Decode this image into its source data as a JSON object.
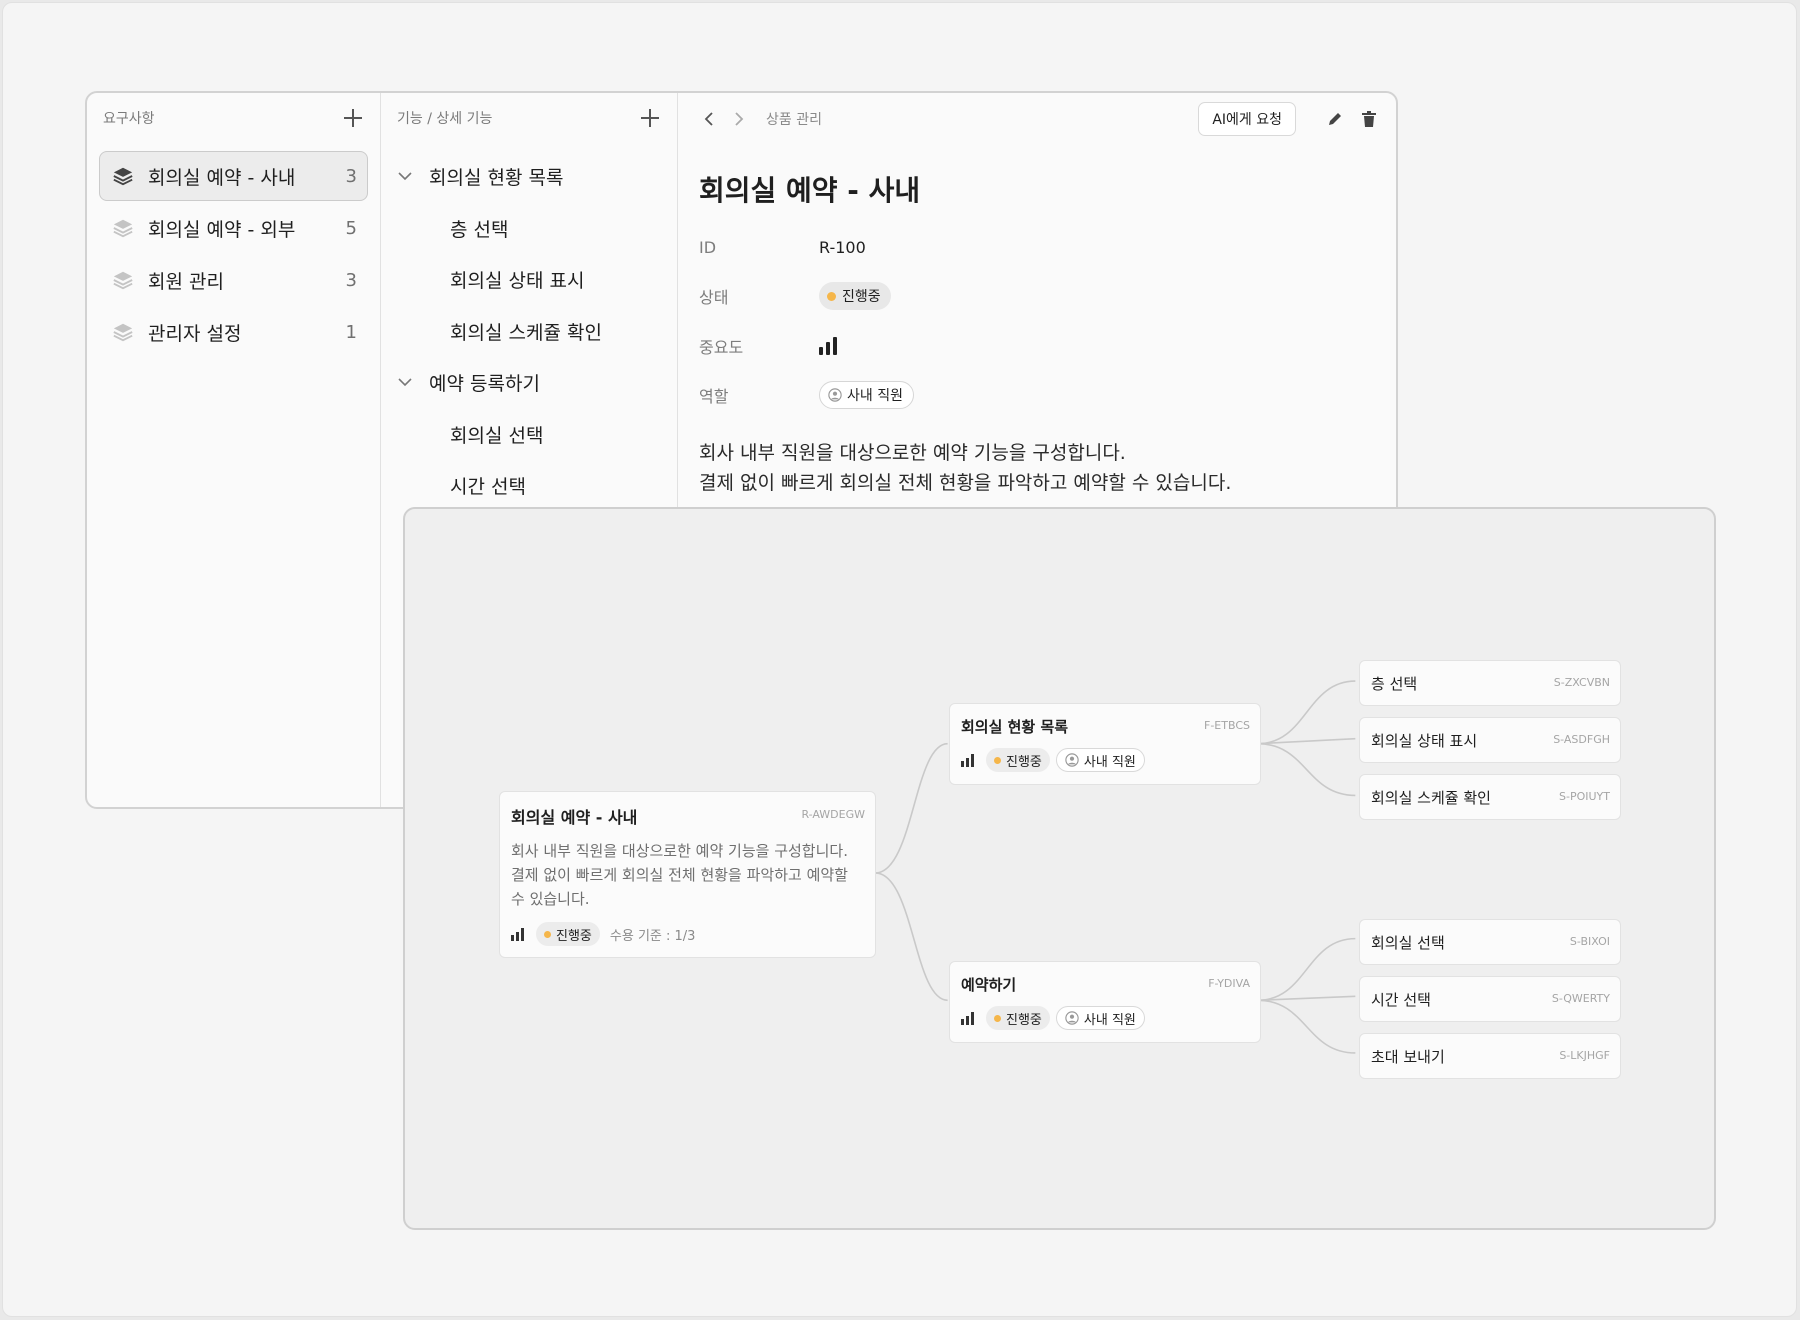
{
  "requirements_panel": {
    "header": "요구사항",
    "items": [
      {
        "label": "회의실 예약 - 사내",
        "count": "3"
      },
      {
        "label": "회의실 예약 - 외부",
        "count": "5"
      },
      {
        "label": "회원 관리",
        "count": "3"
      },
      {
        "label": "관리자 설정",
        "count": "1"
      }
    ]
  },
  "features_panel": {
    "header": "기능 / 상세 기능",
    "groups": [
      {
        "label": "회의실 현황 목록",
        "children": [
          "층 선택",
          "회의실 상태 표시",
          "회의실 스케쥴 확인"
        ]
      },
      {
        "label": "예약 등록하기",
        "children": [
          "회의실 선택",
          "시간 선택"
        ]
      }
    ]
  },
  "detail": {
    "breadcrumb": "상품 관리",
    "ai_button": "AI에게 요청",
    "title": "회의실 예약 - 사내",
    "fields": {
      "id_label": "ID",
      "id_value": "R-100",
      "status_label": "상태",
      "status_value": "진행중",
      "priority_label": "중요도",
      "role_label": "역할",
      "role_value": "사내 직원"
    },
    "description_line1": "회사 내부 직원을 대상으로한 예약 기능을 구성합니다.",
    "description_line2": "결제 없이 빠르게 회의실 전체 현황을 파악하고 예약할 수 있습니다."
  },
  "diagram": {
    "root": {
      "title": "회의실 예약 - 사내",
      "code": "R-AWDEGW",
      "description": "회사 내부 직원을 대상으로한 예약 기능을 구성합니다. 결제 없이 빠르게 회의실 전체 현황을 파악하고 예약할 수 있습니다.",
      "status": "진행중",
      "acceptance": "수용 기준 : 1/3"
    },
    "features": [
      {
        "title": "회의실 현황 목록",
        "code": "F-ETBCS",
        "status": "진행중",
        "role": "사내 직원"
      },
      {
        "title": "예약하기",
        "code": "F-YDIVA",
        "status": "진행중",
        "role": "사내 직원"
      }
    ],
    "subfeatures": [
      {
        "title": "층 선택",
        "code": "S-ZXCVBN"
      },
      {
        "title": "회의실 상태 표시",
        "code": "S-ASDFGH"
      },
      {
        "title": "회의실 스케쥴 확인",
        "code": "S-POIUYT"
      },
      {
        "title": "회의실 선택",
        "code": "S-BIXOI"
      },
      {
        "title": "시간 선택",
        "code": "S-QWERTY"
      },
      {
        "title": "초대 보내기",
        "code": "S-LKJHGF"
      }
    ]
  },
  "colors": {
    "status_dot": "#f5b64a",
    "link": "#c8c8c8"
  }
}
